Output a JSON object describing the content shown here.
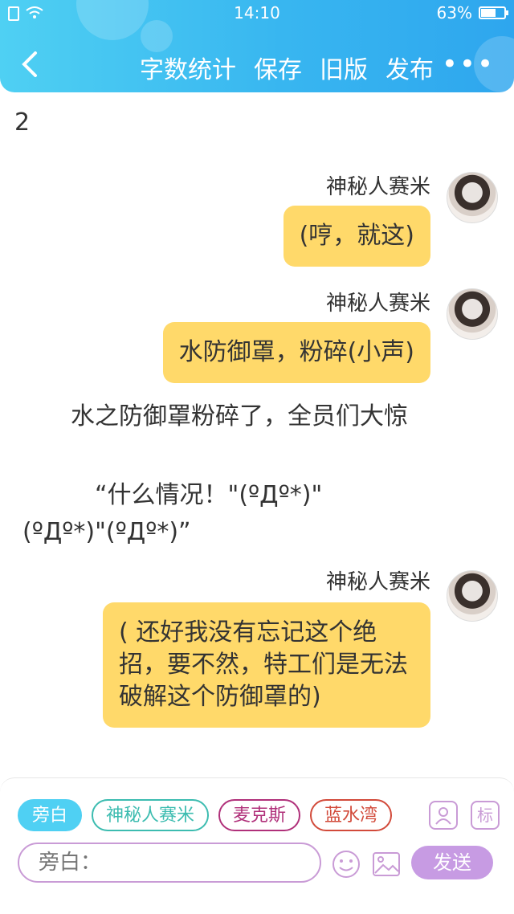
{
  "status": {
    "time": "14:10",
    "battery": "63%",
    "battery_level": 0.63
  },
  "nav": {
    "word_count": "字数统计",
    "save": "保存",
    "old_version": "旧版",
    "publish": "发布",
    "more": "•••"
  },
  "chapter": {
    "number": "2"
  },
  "messages": [
    {
      "name": "神秘人赛米",
      "text": "(哼，就这)"
    },
    {
      "name": "神秘人赛米",
      "text": "水防御罩，粉碎(小声)"
    },
    {
      "name": "神秘人赛米",
      "text": "( 还好我没有忘记这个绝招，要不然，特工们是无法破解这个防御罩的)"
    }
  ],
  "narration": [
    "　　水之防御罩粉碎了，全员们大惊",
    "　　　“什么情况！\"(ºДº*)\"(ºДº*)\"(ºДº*)”"
  ],
  "composer": {
    "roles": [
      "旁白",
      "神秘人赛米",
      "麦克斯",
      "蓝水湾"
    ],
    "tag_button": "标",
    "input_placeholder": "旁白：",
    "send_label": "发送"
  },
  "colors": {
    "accent": "#38b6f0",
    "bubble": "#ffd96a",
    "send": "#c79be3"
  }
}
